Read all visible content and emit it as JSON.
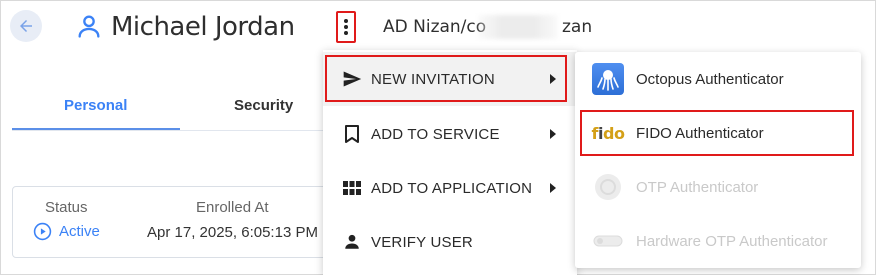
{
  "header": {
    "user_name": "Michael Jordan",
    "breadcrumb_start": "AD Nizan/co",
    "breadcrumb_end": "zan"
  },
  "tabs": [
    {
      "label": "Personal",
      "active": true
    },
    {
      "label": "Security",
      "active": false
    }
  ],
  "card": {
    "status_label": "Status",
    "status_value": "Active",
    "enrolled_label": "Enrolled At",
    "enrolled_value": "Apr 17, 2025, 6:05:13 PM"
  },
  "menu": {
    "items": [
      {
        "label": "NEW INVITATION",
        "icon": "send-icon",
        "has_submenu": true,
        "highlighted": true
      },
      {
        "label": "ADD TO SERVICE",
        "icon": "bookmark-icon",
        "has_submenu": true
      },
      {
        "label": "ADD TO APPLICATION",
        "icon": "grid-icon",
        "has_submenu": true
      },
      {
        "label": "VERIFY USER",
        "icon": "person-icon",
        "has_submenu": false
      }
    ]
  },
  "submenu": {
    "items": [
      {
        "label": "Octopus Authenticator",
        "icon": "octopus-icon",
        "enabled": true
      },
      {
        "label": "FIDO Authenticator",
        "icon": "fido-icon",
        "enabled": true,
        "highlighted": true
      },
      {
        "label": "OTP Authenticator",
        "icon": "otp-icon",
        "enabled": false
      },
      {
        "label": "Hardware OTP Authenticator",
        "icon": "hardware-otp-icon",
        "enabled": false
      }
    ]
  },
  "colors": {
    "accent": "#3b82f6",
    "highlight_border": "#e01a1a",
    "disabled_text": "#c9c9c9"
  }
}
